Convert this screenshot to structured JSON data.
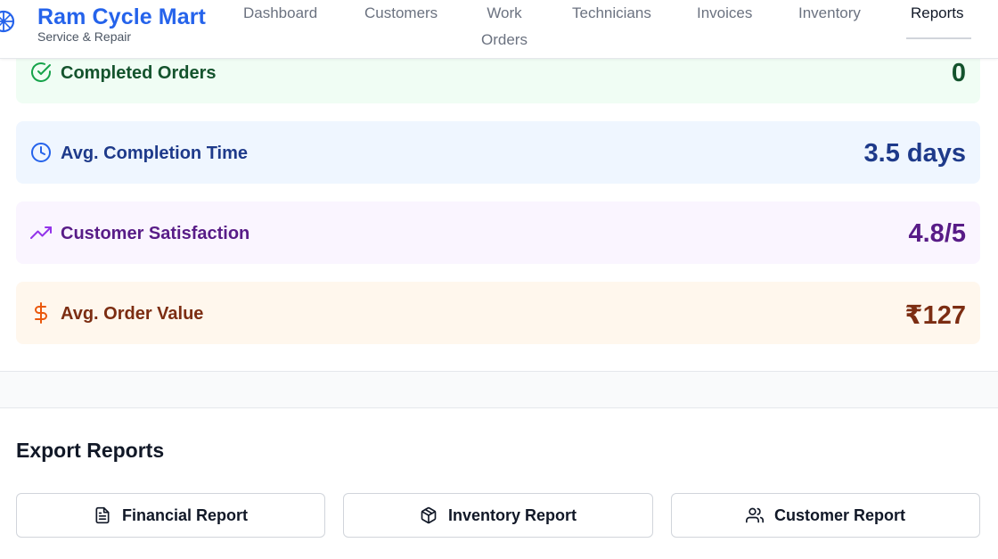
{
  "header": {
    "brand_title": "Ram Cycle Mart",
    "brand_subtitle": "Service & Repair",
    "nav": {
      "dashboard": "Dashboard",
      "customers": "Customers",
      "work_orders_line1": "Work",
      "work_orders_line2": "Orders",
      "technicians": "Technicians",
      "invoices": "Invoices",
      "inventory": "Inventory",
      "reports": "Reports"
    },
    "active_nav": "Reports"
  },
  "stats": {
    "completed": {
      "label": "Completed Orders",
      "value": "0",
      "icon": "check-circle-icon",
      "color": "#16a34a"
    },
    "completion_time": {
      "label": "Avg. Completion Time",
      "value": "3.5 days",
      "icon": "clock-icon",
      "color": "#2563eb"
    },
    "satisfaction": {
      "label": "Customer Satisfaction",
      "value": "4.8/5",
      "icon": "trending-up-icon",
      "color": "#9333ea"
    },
    "order_value": {
      "label": "Avg. Order Value",
      "value": "₹127",
      "icon": "dollar-sign-icon",
      "color": "#ea580c"
    }
  },
  "export": {
    "title": "Export Reports",
    "buttons": {
      "financial": {
        "label": "Financial Report",
        "icon": "file-text-icon"
      },
      "inventory": {
        "label": "Inventory Report",
        "icon": "package-icon"
      },
      "customer": {
        "label": "Customer Report",
        "icon": "users-icon"
      }
    }
  }
}
